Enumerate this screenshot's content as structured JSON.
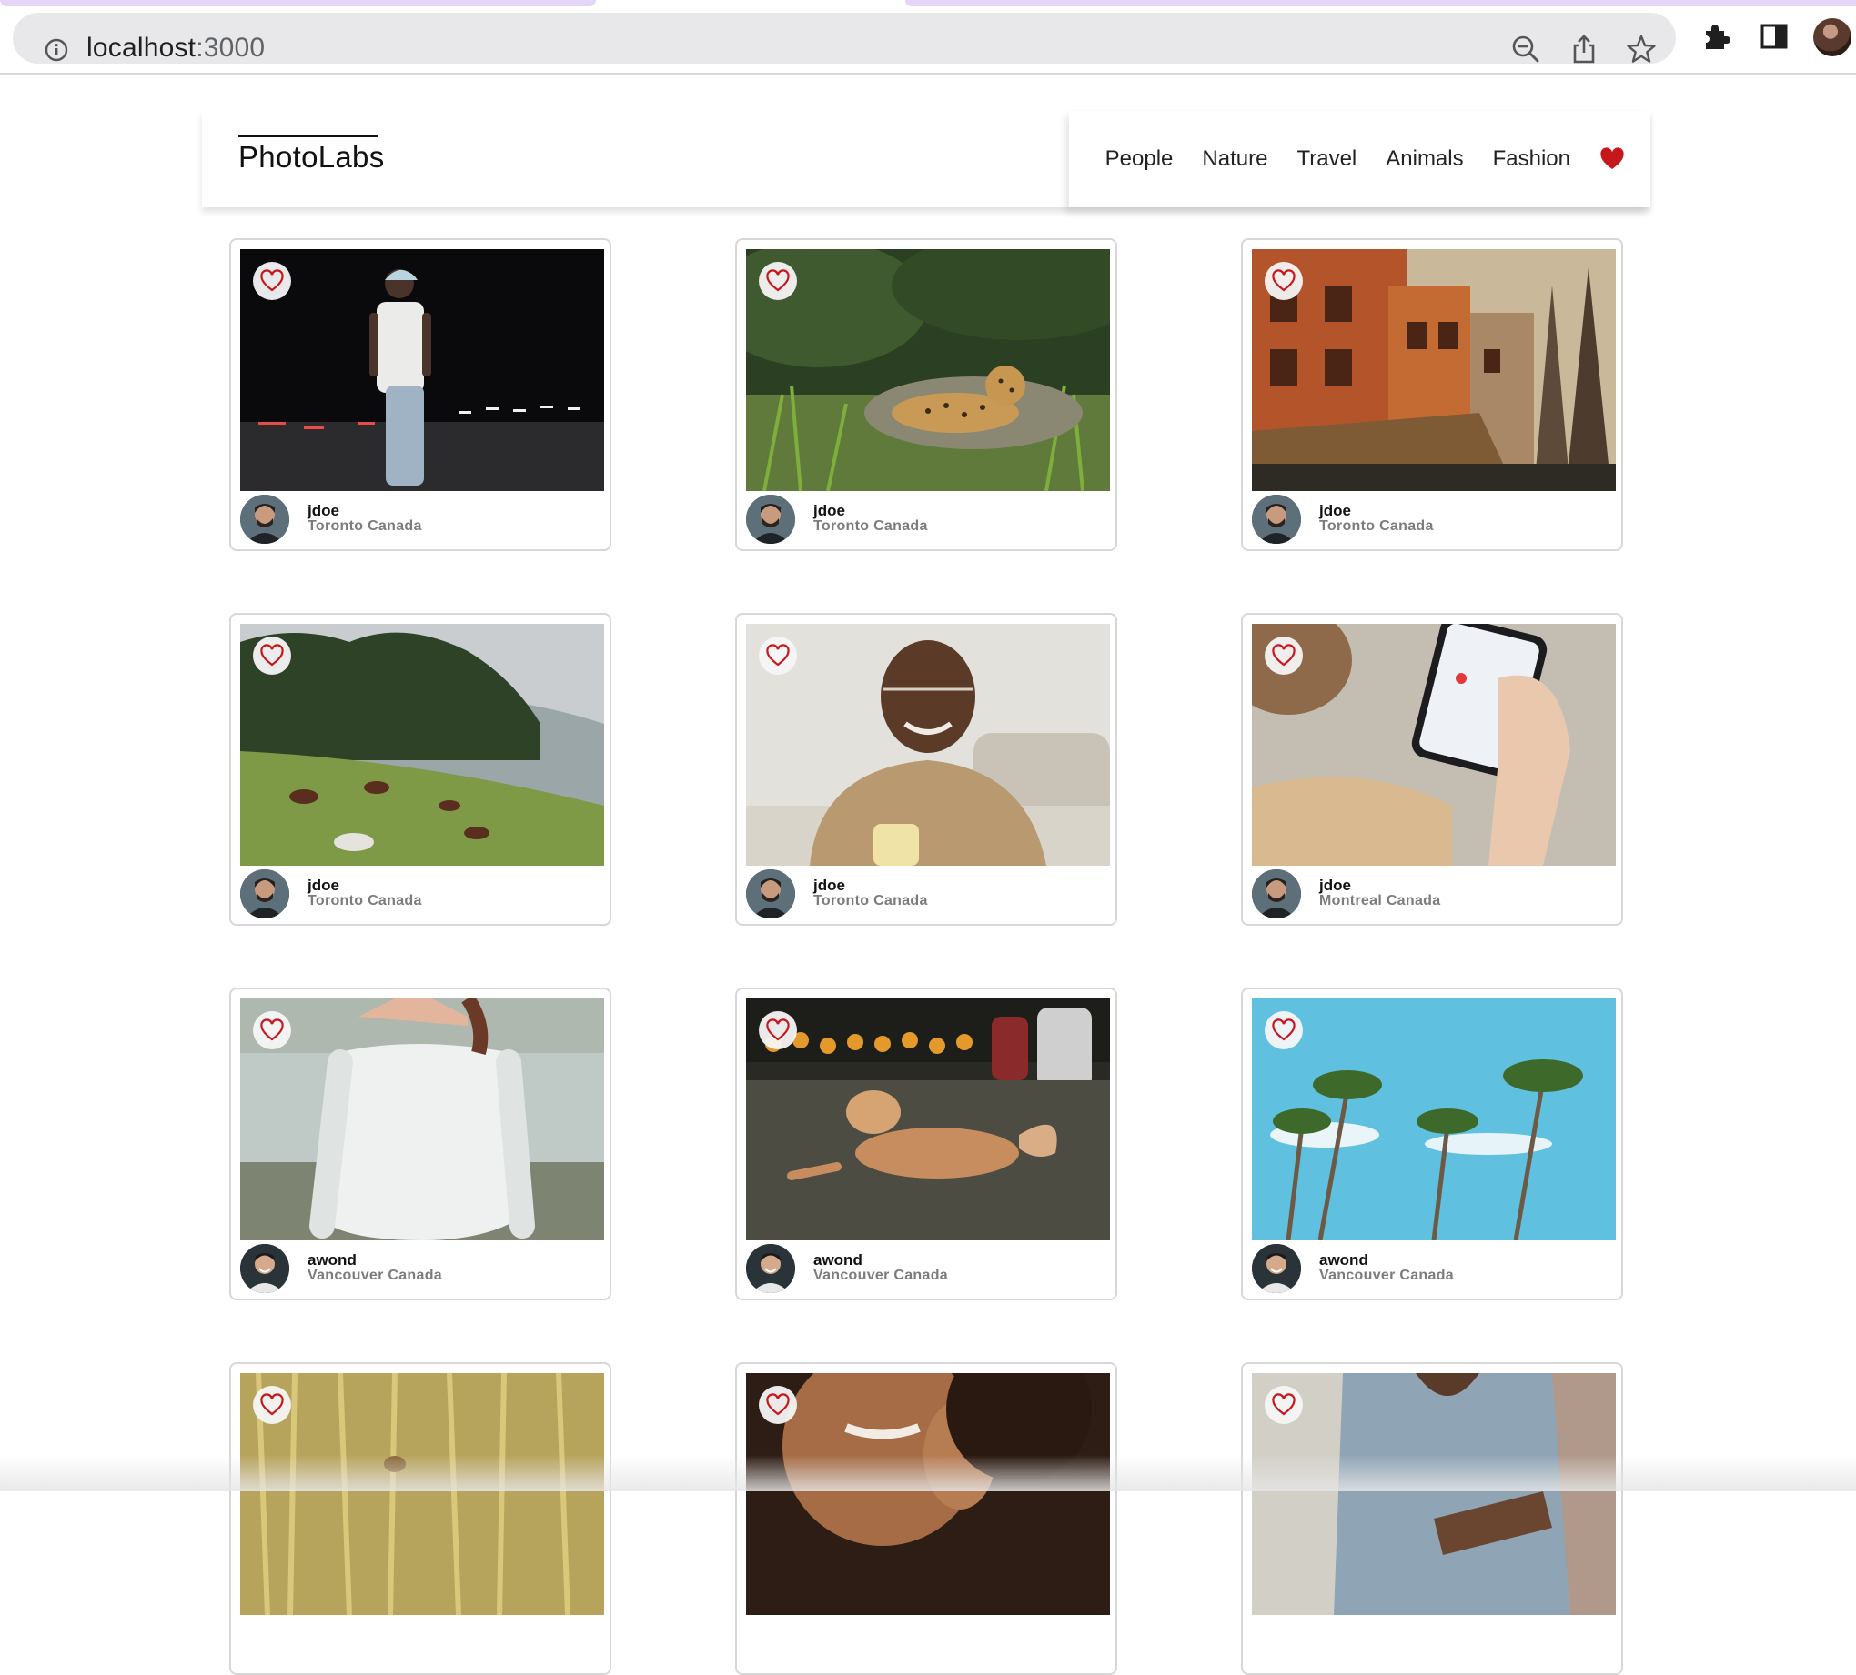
{
  "browser": {
    "url_host": "localhost",
    "url_port": ":3000",
    "icons": [
      "info-icon",
      "zoom-out-icon",
      "share-icon",
      "star-icon",
      "extensions-icon",
      "sidepanel-icon",
      "profile-avatar"
    ]
  },
  "nav": {
    "brand": "PhotoLabs",
    "topics": [
      "People",
      "Nature",
      "Travel",
      "Animals",
      "Fashion"
    ],
    "fav_icon": "heart-icon"
  },
  "colors": {
    "accent": "#c8161d",
    "card_border": "#d7d7d9",
    "muted_text": "#7c7c7c"
  },
  "photos": [
    {
      "user": "jdoe",
      "location": "Toronto Canada"
    },
    {
      "user": "jdoe",
      "location": "Toronto Canada"
    },
    {
      "user": "jdoe",
      "location": "Toronto Canada"
    },
    {
      "user": "jdoe",
      "location": "Toronto Canada"
    },
    {
      "user": "jdoe",
      "location": "Toronto Canada"
    },
    {
      "user": "jdoe",
      "location": "Montreal Canada"
    },
    {
      "user": "awond",
      "location": "Vancouver Canada"
    },
    {
      "user": "awond",
      "location": "Vancouver Canada"
    },
    {
      "user": "awond",
      "location": "Vancouver Canada"
    },
    {
      "user": "",
      "location": ""
    },
    {
      "user": "",
      "location": ""
    },
    {
      "user": "",
      "location": ""
    }
  ]
}
